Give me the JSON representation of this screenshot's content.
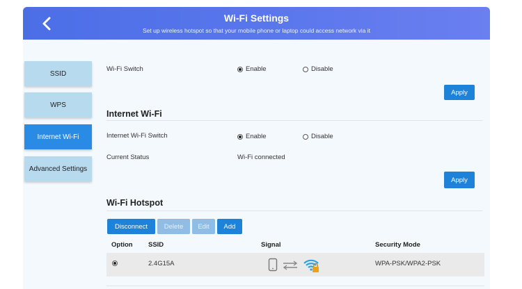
{
  "header": {
    "title": "Wi-Fi Settings",
    "subtitle": "Set up wireless hotspot so that your mobile phone or laptop could access network via it"
  },
  "sidebar": {
    "items": [
      {
        "label": "SSID"
      },
      {
        "label": "WPS"
      },
      {
        "label": "Internet Wi-Fi",
        "active": true
      },
      {
        "label": "Advanced Settings"
      }
    ]
  },
  "wifi_switch": {
    "label": "Wi-Fi Switch",
    "enable_label": "Enable",
    "disable_label": "Disable",
    "selected": "Enable",
    "apply_label": "Apply"
  },
  "internet_wifi": {
    "title": "Internet Wi-Fi",
    "switch_label": "Internet Wi-Fi Switch",
    "enable_label": "Enable",
    "disable_label": "Disable",
    "selected": "Enable",
    "status_label": "Current Status",
    "status_value": "Wi-Fi connected",
    "apply_label": "Apply"
  },
  "hotspot": {
    "title": "Wi-Fi Hotspot",
    "buttons": {
      "disconnect": "Disconnect",
      "delete": "Delete",
      "edit": "Edit",
      "add": "Add"
    },
    "columns": [
      "Option",
      "SSID",
      "Signal",
      "Security Mode"
    ],
    "rows": [
      {
        "selected": true,
        "ssid": "2.4G15A",
        "security": "WPA-PSK/WPA2-PSK"
      }
    ]
  },
  "colors": {
    "header": "#5976ec",
    "accent": "#1e82d8",
    "nav": "#b8daee",
    "nav_active": "#2a8be4",
    "panel": "#f3f9fd"
  }
}
